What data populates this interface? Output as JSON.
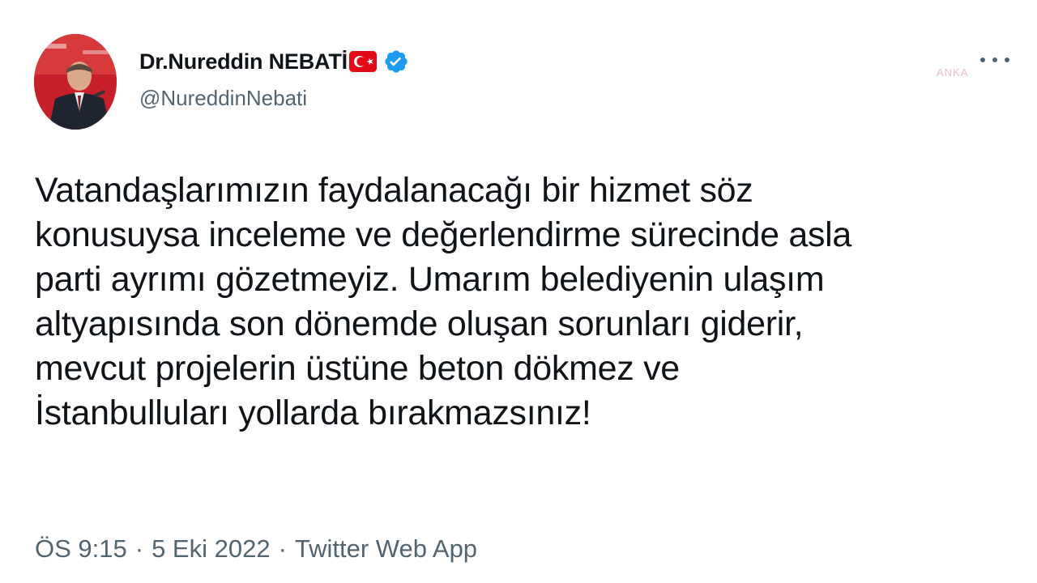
{
  "tweet": {
    "author": {
      "display_name": "Dr.Nureddin NEBATİ",
      "handle": "@NureddinNebati",
      "verified": true,
      "flag": "turkey-flag-icon"
    },
    "watermark": "ANKA",
    "text": "Vatandaşlarımızın faydalanacağı bir hizmet söz\nkonusuysa inceleme ve değerlendirme sürecinde asla\nparti ayrımı gözetmeyiz. Umarım belediyenin ulaşım\naltyapısında son dönemde oluşan sorunları giderir,\nmevcut projelerin üstüne beton dökmez ve\nİstanbulluları yollarda bırakmazsınız!",
    "time": "ÖS 9:15",
    "date": "5 Eki 2022",
    "source": "Twitter Web App",
    "separator": "·"
  },
  "colors": {
    "verified_blue": "#1d9bf0",
    "flag_red": "#e30a17",
    "secondary_text": "#536471",
    "primary_text": "#0f1419"
  }
}
